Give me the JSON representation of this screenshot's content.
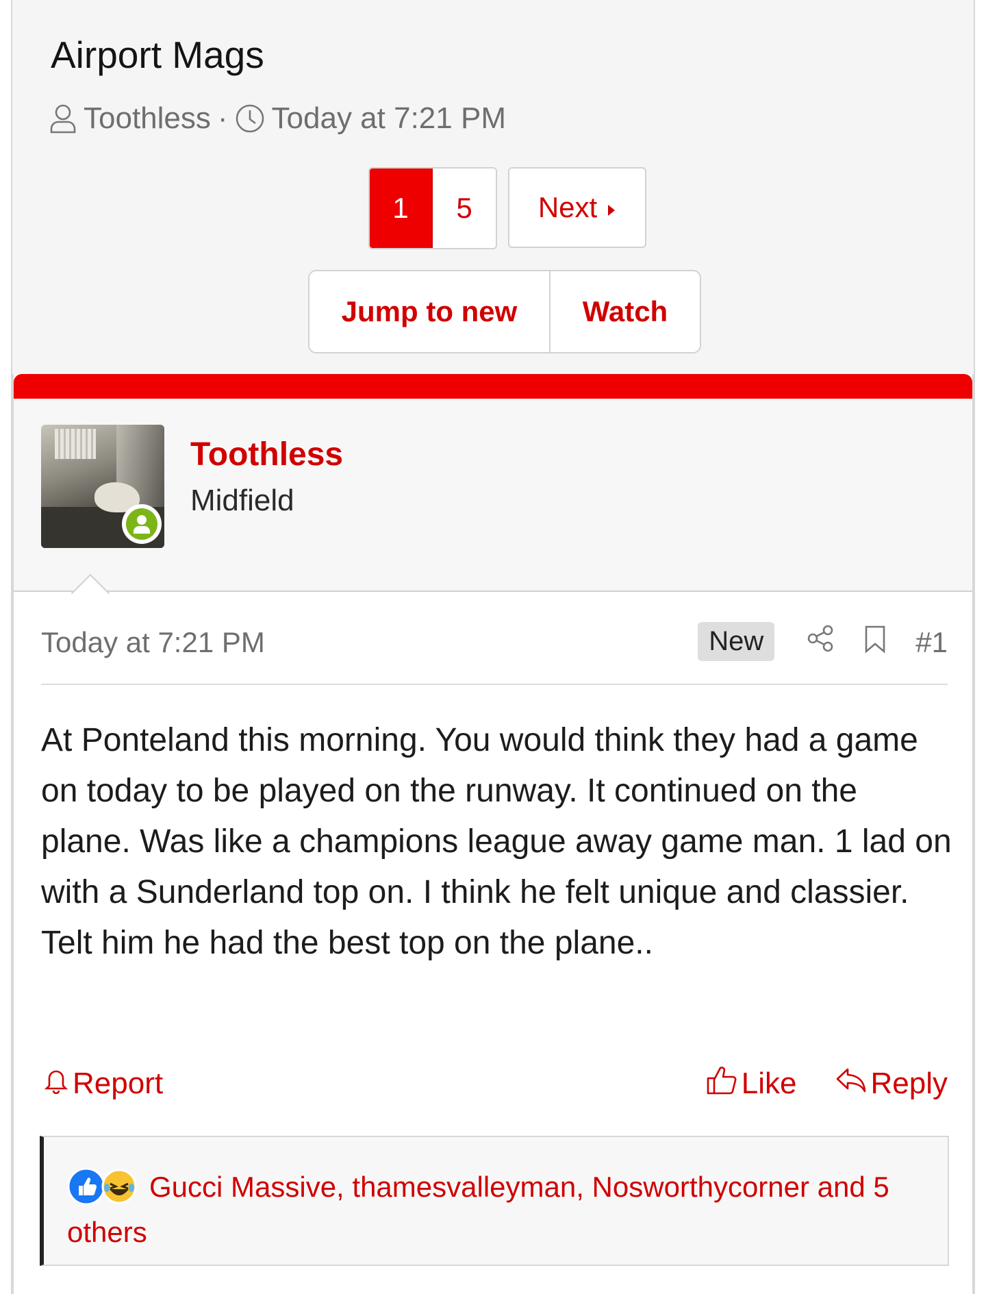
{
  "thread": {
    "title": "Airport Mags",
    "author": "Toothless",
    "separator": "·",
    "date": "Today at 7:21 PM"
  },
  "pagination": {
    "pages": [
      "1",
      "5"
    ],
    "current": "1",
    "next_label": "Next"
  },
  "thread_actions": {
    "jump_label": "Jump to new",
    "watch_label": "Watch"
  },
  "post": {
    "username": "Toothless",
    "user_title": "Midfield",
    "date": "Today at 7:21 PM",
    "new_badge": "New",
    "number": "#1",
    "body": "At Ponteland this morning. You would think they had a game on today to be played on the runway. It continued on the plane. Was like a champions league away game man. 1 lad on with a Sunderland top on. I think he felt unique and classier. Telt him he had the best top on the plane..",
    "report_label": "Report",
    "like_label": "Like",
    "reply_label": "Reply",
    "reactions_text": "Gucci Massive, thamesvalleyman, Nosworthycorner and 5 others"
  },
  "colors": {
    "accent": "#d00000",
    "accent_bar": "#ee0000",
    "online": "#7cb518"
  },
  "icons": [
    "user-icon",
    "clock-icon",
    "caret-right-icon",
    "share-icon",
    "bookmark-icon",
    "bell-icon",
    "thumbs-up-icon",
    "reply-icon",
    "like-reaction-icon",
    "laugh-reaction-icon",
    "online-user-icon"
  ]
}
